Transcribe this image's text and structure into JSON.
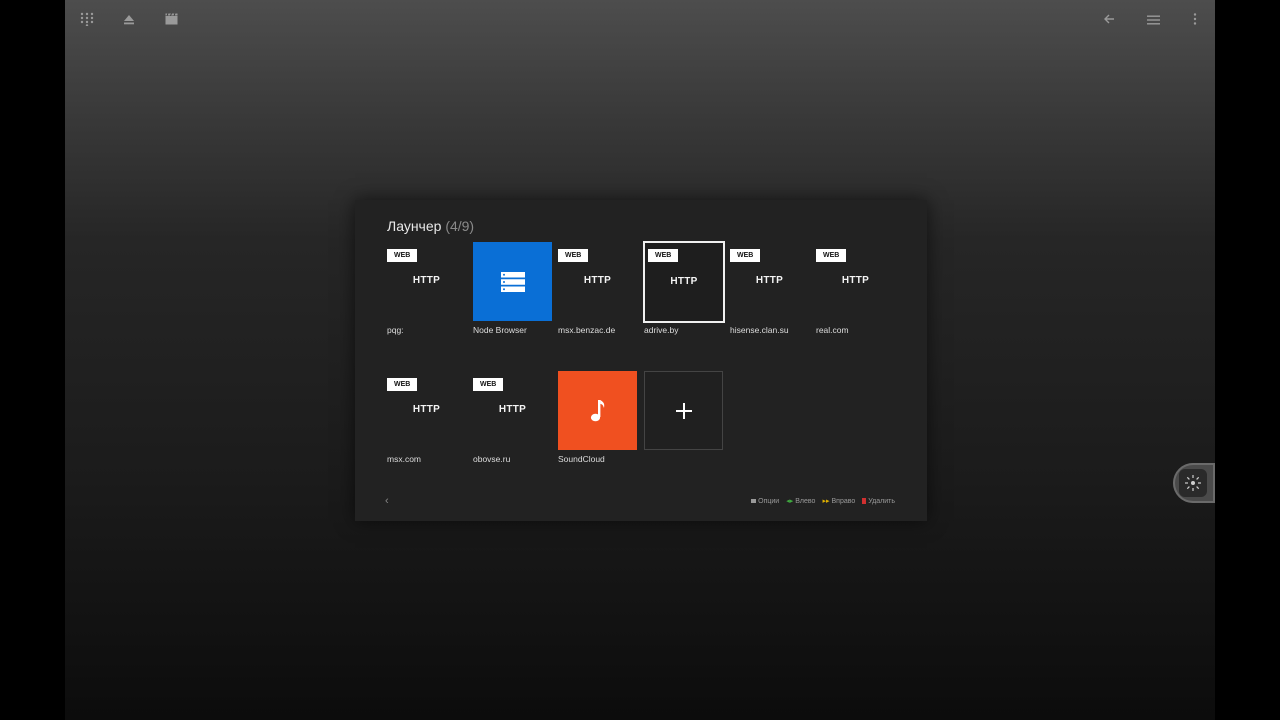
{
  "topbar": {
    "left_icons": [
      "dialpad-icon",
      "eject-icon",
      "movie-clapper-icon"
    ],
    "right_icons": [
      "back-arrow-icon",
      "menu-icon",
      "more-vert-icon"
    ]
  },
  "launcher": {
    "title": "Лаунчер",
    "count": "(4/9)",
    "tiles": [
      {
        "type": "web",
        "badge": "WEB",
        "label": "HTTP",
        "caption": "pqg:"
      },
      {
        "type": "icon",
        "icon": "server-list-icon",
        "caption": "Node Browser",
        "color": "#0a6fd6"
      },
      {
        "type": "web",
        "badge": "WEB",
        "label": "HTTP",
        "caption": "msx.benzac.de"
      },
      {
        "type": "web",
        "badge": "WEB",
        "label": "HTTP",
        "caption": "adrive.by",
        "focused": true
      },
      {
        "type": "web",
        "badge": "WEB",
        "label": "HTTP",
        "caption": "hisense.clan.su"
      },
      {
        "type": "web",
        "badge": "WEB",
        "label": "HTTP",
        "caption": "real.com"
      },
      {
        "type": "web",
        "badge": "WEB",
        "label": "HTTP",
        "caption": "msx.com"
      },
      {
        "type": "web",
        "badge": "WEB",
        "label": "HTTP",
        "caption": "obovse.ru"
      },
      {
        "type": "icon",
        "icon": "music-note-icon",
        "caption": "SoundCloud",
        "color": "#f05020"
      },
      {
        "type": "add",
        "icon": "plus-icon"
      }
    ],
    "footer": {
      "prev_symbol": "‹",
      "hints": [
        {
          "label": "Опции",
          "color": "#9a9a9a"
        },
        {
          "label": "Влево",
          "color": "#3faa3f"
        },
        {
          "label": "Вправо",
          "color": "#e0b000"
        },
        {
          "label": "Удалить",
          "color": "#d03030"
        }
      ]
    }
  },
  "side_button": {
    "icon": "settings-sparkle-icon"
  }
}
